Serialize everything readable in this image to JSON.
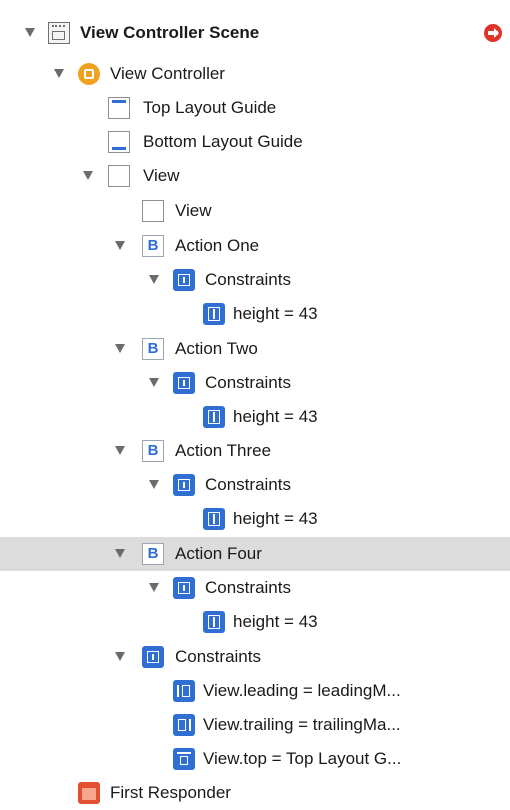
{
  "outline": {
    "scene_label": "View Controller Scene",
    "view_controller_label": "View Controller",
    "top_layout_guide_label": "Top Layout Guide",
    "bottom_layout_guide_label": "Bottom Layout Guide",
    "view_label": "View",
    "subview_label": "View",
    "buttons": [
      {
        "label": "Action One",
        "icon": "B",
        "constraints_label": "Constraints",
        "height_constraint": "height = 43"
      },
      {
        "label": "Action Two",
        "icon": "B",
        "constraints_label": "Constraints",
        "height_constraint": "height = 43"
      },
      {
        "label": "Action Three",
        "icon": "B",
        "constraints_label": "Constraints",
        "height_constraint": "height = 43"
      },
      {
        "label": "Action Four",
        "icon": "B",
        "constraints_label": "Constraints",
        "height_constraint": "height = 43"
      }
    ],
    "view_constraints_label": "Constraints",
    "view_constraints": [
      {
        "label": "View.leading = leadingM...",
        "icon": "leading-constraint-icon"
      },
      {
        "label": "View.trailing = trailingMa...",
        "icon": "trailing-constraint-icon"
      },
      {
        "label": "View.top = Top Layout G...",
        "icon": "top-constraint-icon"
      }
    ],
    "first_responder_label": "First Responder",
    "selected_item": "Action Four",
    "colors": {
      "selection": "#dcdcdc",
      "constraint_icon": "#2f6fd3",
      "view_controller_icon": "#f0a21e",
      "warning": "#e0342a",
      "first_responder_icon": "#e2502f"
    }
  }
}
